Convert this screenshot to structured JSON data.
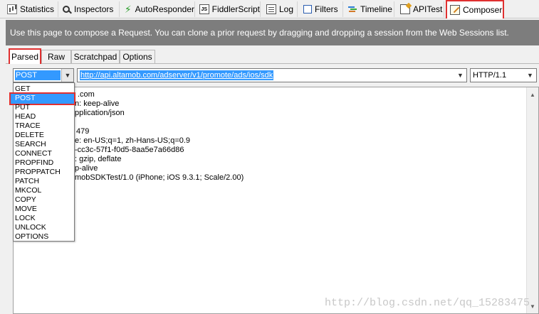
{
  "top_tabs": [
    {
      "label": "Statistics",
      "icon": "statistics-icon"
    },
    {
      "label": "Inspectors",
      "icon": "inspectors-icon"
    },
    {
      "label": "AutoResponder",
      "icon": "lightning-icon"
    },
    {
      "label": "FiddlerScript",
      "icon": "script-icon"
    },
    {
      "label": "Log",
      "icon": "log-icon"
    },
    {
      "label": "Filters",
      "icon": "filter-icon"
    },
    {
      "label": "Timeline",
      "icon": "timeline-icon"
    },
    {
      "label": "APITest",
      "icon": "apitest-icon"
    },
    {
      "label": "Composer",
      "icon": "composer-icon",
      "active": true
    }
  ],
  "info_bar": "Use this page to compose a Request. You can clone a prior request by dragging and dropping a session from the Web Sessions list.",
  "sub_tabs": [
    {
      "label": "Parsed",
      "active": true
    },
    {
      "label": "Raw"
    },
    {
      "label": "Scratchpad"
    },
    {
      "label": "Options"
    }
  ],
  "request": {
    "method": "POST",
    "url": "http://api.altamob.com/adserver/v1/promote/ads/ios/sdk",
    "version": "HTTP/1.1"
  },
  "method_options": [
    "GET",
    "POST",
    "PUT",
    "HEAD",
    "TRACE",
    "DELETE",
    "SEARCH",
    "CONNECT",
    "PROPFIND",
    "PROPPATCH",
    "PATCH",
    "MKCOL",
    "COPY",
    "MOVE",
    "LOCK",
    "UNLOCK",
    "OPTIONS"
  ],
  "selected_option": "POST",
  "header_lines_visible": [
    ".com",
    "n: keep-alive",
    "pplication/json",
    "",
    "479",
    "e: en-US;q=1, zh-Hans-US;q=0.9",
    "-cc3c-57f1-f0d5-8aa5e7a66d86",
    ": gzip, deflate",
    "p-alive",
    "mobSDKTest/1.0 (iPhone; iOS 9.3.1; Scale/2.00)"
  ],
  "watermark": "http://blog.csdn.net/qq_15283475",
  "colors": {
    "accent": "#e03030",
    "selection": "#3399ff",
    "info_bar": "#7d7d7d"
  }
}
